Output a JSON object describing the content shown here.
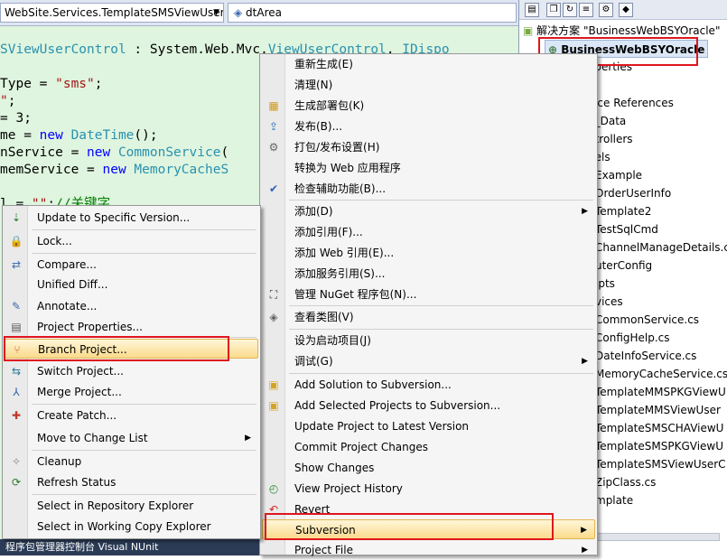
{
  "editor": {
    "type_combo": "WebSite.Services.TemplateSMSViewUser",
    "member_combo": "dtArea",
    "code": [
      {
        "parts": [
          [
            "ty",
            "SViewUserControl"
          ],
          [
            "n",
            " : System.Web.Mvc."
          ],
          [
            "ty",
            "ViewUserControl"
          ],
          [
            "n",
            ", "
          ],
          [
            "ty",
            "IDispo"
          ]
        ]
      },
      {
        "parts": []
      },
      {
        "parts": [
          [
            "n",
            "Type = "
          ],
          [
            "st",
            "\"sms\""
          ],
          [
            "n",
            ";"
          ]
        ]
      },
      {
        "parts": [
          [
            "st",
            "\""
          ],
          [
            "n",
            ";"
          ]
        ]
      },
      {
        "parts": [
          [
            "n",
            "= 3;"
          ]
        ]
      },
      {
        "parts": [
          [
            "n",
            "me = "
          ],
          [
            "kw",
            "new "
          ],
          [
            "ty",
            "DateTime"
          ],
          [
            "n",
            "();"
          ]
        ]
      },
      {
        "parts": [
          [
            "n",
            "nService = "
          ],
          [
            "kw",
            "new "
          ],
          [
            "ty",
            "CommonService"
          ],
          [
            "n",
            "("
          ]
        ]
      },
      {
        "parts": [
          [
            "n",
            "memService = "
          ],
          [
            "kw",
            "new "
          ],
          [
            "ty",
            "MemoryCacheS"
          ]
        ]
      },
      {
        "parts": []
      },
      {
        "parts": [
          [
            "n",
            "l = "
          ],
          [
            "st",
            "\"\""
          ],
          [
            "n",
            ";"
          ],
          [
            "cm",
            "//关键字"
          ]
        ]
      }
    ]
  },
  "taskbar": {
    "label": "程序包管理器控制台    Visual NUnit"
  },
  "solution_explorer": {
    "solution_label": "解决方案 \"BusinessWebBSYOracle\"",
    "project_label": "BusinessWebBSYOracle",
    "items": [
      "operties",
      "用",
      "vice References",
      "p_Data",
      "ntrollers",
      "dels",
      "Example",
      "OrderUserInfo",
      "Template2",
      "TestSqlCmd",
      "ChannelManageDetails.c",
      "uterConfig",
      "ipts",
      "vices",
      "CommonService.cs",
      "ConfigHelp.cs",
      "DateInfoService.cs",
      "MemoryCacheService.cs",
      "TemplateMMSPKGViewU",
      "TemplateMMSViewUser",
      "TemplateSMSCHAViewU",
      "TemplateSMSPKGViewU",
      "TemplateSMSViewUserC",
      "ZipClass.cs",
      "mplate"
    ]
  },
  "context_menu": {
    "items": [
      {
        "label": "重新生成(E)",
        "icon": "none"
      },
      {
        "label": "清理(N)",
        "icon": "none"
      },
      {
        "label": "生成部署包(K)",
        "icon": "package-icon"
      },
      {
        "label": "发布(B)...",
        "icon": "publish-icon"
      },
      {
        "label": "打包/发布设置(H)",
        "icon": "settings-icon"
      },
      {
        "label": "转换为 Web 应用程序",
        "icon": "none"
      },
      {
        "label": "检查辅助功能(B)...",
        "icon": "accessibility-icon"
      },
      {
        "label": "添加(D)",
        "icon": "none",
        "submenu": true
      },
      {
        "label": "添加引用(F)...",
        "icon": "none"
      },
      {
        "label": "添加 Web 引用(E)...",
        "icon": "none"
      },
      {
        "label": "添加服务引用(S)...",
        "icon": "none"
      },
      {
        "label": "管理 NuGet 程序包(N)...",
        "icon": "nuget-icon"
      },
      {
        "label": "查看类图(V)",
        "icon": "class-diagram-icon"
      },
      {
        "label": "设为启动项目(J)",
        "icon": "none"
      },
      {
        "label": "调试(G)",
        "icon": "none",
        "submenu": true
      },
      {
        "label": "Add Solution to Subversion...",
        "icon": "add-folder-icon"
      },
      {
        "label": "Add Selected Projects to Subversion...",
        "icon": "add-folder-icon"
      },
      {
        "label": "Update Project to Latest Version",
        "icon": "none"
      },
      {
        "label": "Commit Project Changes",
        "icon": "none"
      },
      {
        "label": "Show Changes",
        "icon": "none"
      },
      {
        "label": "View Project History",
        "icon": "history-icon"
      },
      {
        "label": "Revert",
        "icon": "revert-icon"
      },
      {
        "label": "Subversion",
        "icon": "none",
        "submenu": true
      },
      {
        "label": "Project File",
        "icon": "none",
        "submenu": true
      }
    ]
  },
  "subversion_menu": {
    "items": [
      {
        "label": "Update to Specific Version...",
        "icon": "update-icon"
      },
      {
        "label": "Lock...",
        "icon": "lock-icon"
      },
      {
        "label": "Compare...",
        "icon": "compare-icon"
      },
      {
        "label": "Unified Diff...",
        "icon": "none"
      },
      {
        "label": "Annotate...",
        "icon": "annotate-icon"
      },
      {
        "label": "Project Properties...",
        "icon": "properties-icon"
      },
      {
        "label": "Branch Project...",
        "icon": "branch-icon"
      },
      {
        "label": "Switch Project...",
        "icon": "switch-icon"
      },
      {
        "label": "Merge Project...",
        "icon": "merge-icon"
      },
      {
        "label": "Create Patch...",
        "icon": "patch-icon"
      },
      {
        "label": "Move to Change List",
        "icon": "none",
        "submenu": true
      },
      {
        "label": "Cleanup",
        "icon": "cleanup-icon"
      },
      {
        "label": "Refresh Status",
        "icon": "refresh-icon"
      },
      {
        "label": "Select in Repository Explorer",
        "icon": "none"
      },
      {
        "label": "Select in Working Copy Explorer",
        "icon": "none"
      }
    ]
  },
  "colors": {
    "highlight_border": "#e2b652",
    "annotation_red": "#e0161e"
  }
}
